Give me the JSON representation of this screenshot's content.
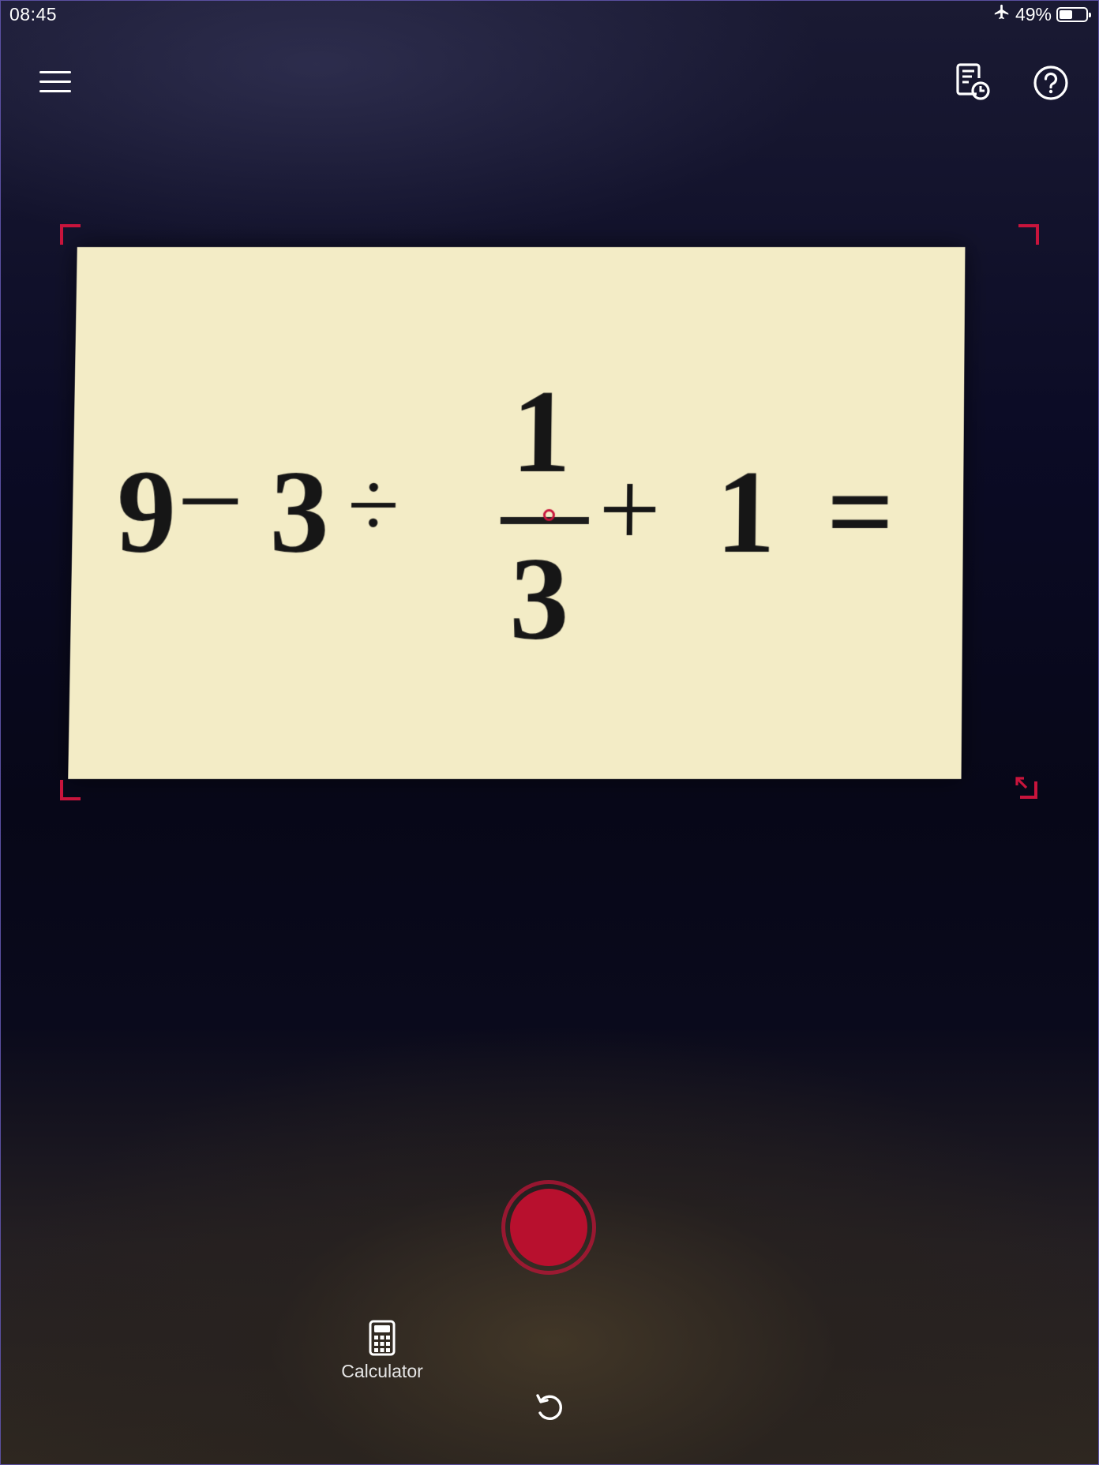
{
  "status_bar": {
    "time": "08:45",
    "airplane_mode_icon": "airplane-icon",
    "battery_percent": "49%",
    "battery_level": 0.49
  },
  "toolbar": {
    "menu_icon": "hamburger-menu-icon",
    "history_icon": "history-icon",
    "help_icon": "help-icon"
  },
  "scan": {
    "equation": {
      "t1": "9",
      "op1": "−",
      "t2": "3",
      "op2": "÷",
      "numerator": "1",
      "denominator": "3",
      "op3": "+",
      "t3": "1",
      "equals": "="
    },
    "frame_color": "#c8143c"
  },
  "bottom": {
    "shutter_color": "#b8102e",
    "calculator_label": "Calculator",
    "calculator_icon": "calculator-icon",
    "reset_icon": "reset-icon"
  }
}
